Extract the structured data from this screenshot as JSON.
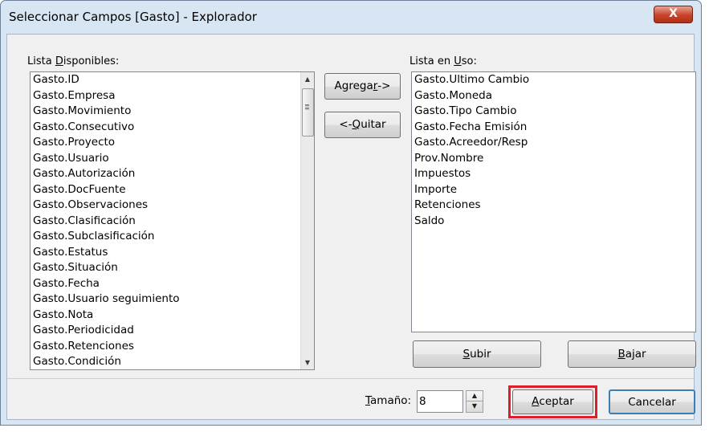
{
  "window": {
    "title": "Seleccionar Campos [Gasto] - Explorador",
    "close_label": "X"
  },
  "available": {
    "label_pre": "Lista ",
    "label_ul": "D",
    "label_post": "isponibles:",
    "items": [
      "Gasto.ID",
      "Gasto.Empresa",
      "Gasto.Movimiento",
      "Gasto.Consecutivo",
      "Gasto.Proyecto",
      "Gasto.Usuario",
      "Gasto.Autorización",
      "Gasto.DocFuente",
      "Gasto.Observaciones",
      "Gasto.Clasificación",
      "Gasto.Subclasificación",
      "Gasto.Estatus",
      "Gasto.Situación",
      "Gasto.Fecha",
      "Gasto.Usuario seguimiento",
      "Gasto.Nota",
      "Gasto.Periodicidad",
      "Gasto.Retenciones",
      "Gasto.Condición"
    ]
  },
  "inuse": {
    "label_pre": "Lista en ",
    "label_ul": "U",
    "label_post": "so:",
    "items": [
      "Gasto.Ultimo Cambio",
      "Gasto.Moneda",
      "Gasto.Tipo Cambio",
      "Gasto.Fecha Emisión",
      "Gasto.Acreedor/Resp",
      "Prov.Nombre",
      "Impuestos",
      "Importe",
      "Retenciones",
      "Saldo"
    ]
  },
  "buttons": {
    "add_pre": "Agrega",
    "add_ul": "r",
    "add_post": " ->",
    "remove_pre": "<- ",
    "remove_ul": "Q",
    "remove_post": "uitar",
    "up_ul": "S",
    "up_post": "ubir",
    "down_ul": "B",
    "down_post": "ajar",
    "ok_ul": "A",
    "ok_post": "ceptar",
    "cancel": "Cancelar"
  },
  "size": {
    "label_ul": "T",
    "label_post": "amaño:",
    "value": "8"
  },
  "icons": {
    "close": "close-icon",
    "scroll_up": "scroll-up-arrow-icon",
    "scroll_down": "scroll-down-arrow-icon",
    "spin_up": "spin-up-arrow-icon",
    "spin_down": "spin-down-arrow-icon"
  },
  "colors": {
    "highlight_outline": "#d9202b",
    "close_button": "#c7432a"
  }
}
